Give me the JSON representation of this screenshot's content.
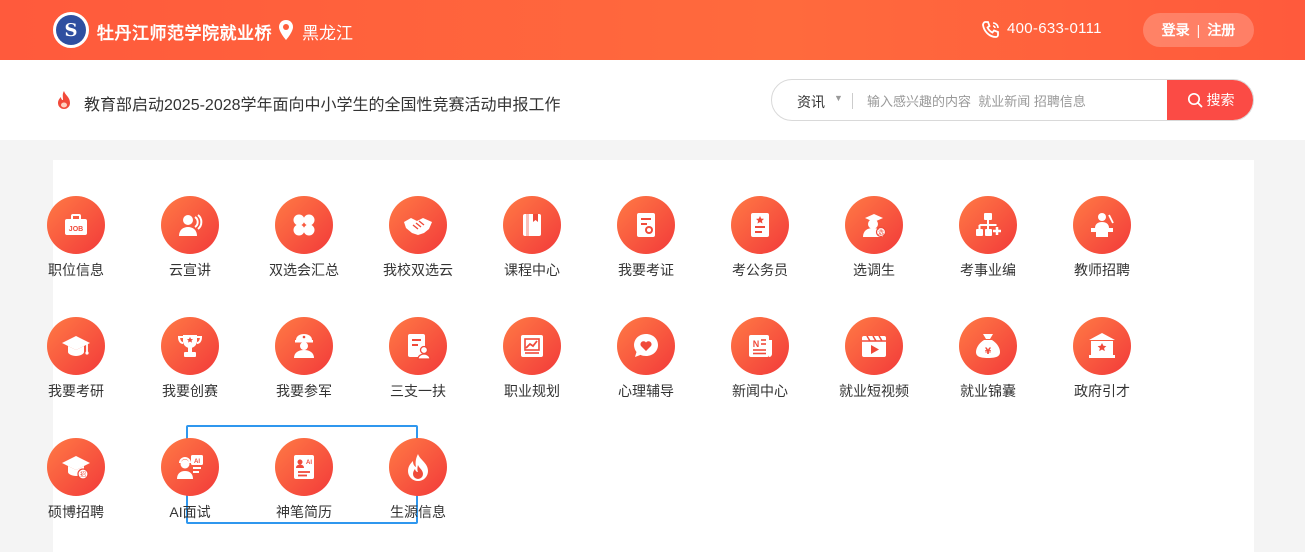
{
  "header": {
    "logo_text": "S",
    "site_name": "牡丹江师范学院就业桥",
    "location": "黑龙江",
    "phone": "400-633-0111",
    "login_label": "登录",
    "separator": "|",
    "register_label": "注册"
  },
  "news": {
    "headline": "教育部启动2025-2028学年面向中小学生的全国性竞赛活动申报工作"
  },
  "search": {
    "category": "资讯",
    "caret": "▼",
    "placeholder": "输入感兴趣的内容  就业新闻 招聘信息",
    "button_label": "搜索"
  },
  "services": [
    {
      "label": "职位信息",
      "icon": "job-icon"
    },
    {
      "label": "云宣讲",
      "icon": "presenter-icon"
    },
    {
      "label": "双选会汇总",
      "icon": "clover-icon"
    },
    {
      "label": "我校双选云",
      "icon": "handshake-icon"
    },
    {
      "label": "课程中心",
      "icon": "book-icon"
    },
    {
      "label": "我要考证",
      "icon": "certificate-icon"
    },
    {
      "label": "考公务员",
      "icon": "document-star-icon"
    },
    {
      "label": "选调生",
      "icon": "official-icon"
    },
    {
      "label": "考事业编",
      "icon": "org-chart-icon"
    },
    {
      "label": "教师招聘",
      "icon": "teacher-icon"
    },
    {
      "label": "我要考研",
      "icon": "graduation-cap-icon"
    },
    {
      "label": "我要创赛",
      "icon": "trophy-icon"
    },
    {
      "label": "我要参军",
      "icon": "soldier-icon"
    },
    {
      "label": "三支一扶",
      "icon": "document-person-icon"
    },
    {
      "label": "职业规划",
      "icon": "chart-board-icon"
    },
    {
      "label": "心理辅导",
      "icon": "heart-bubble-icon"
    },
    {
      "label": "新闻中心",
      "icon": "newspaper-icon"
    },
    {
      "label": "就业短视频",
      "icon": "video-icon"
    },
    {
      "label": "就业锦囊",
      "icon": "money-bag-icon"
    },
    {
      "label": "政府引才",
      "icon": "government-icon"
    },
    {
      "label": "硕博招聘",
      "icon": "doctoral-cap-icon"
    },
    {
      "label": "AI面试",
      "icon": "ai-interview-icon"
    },
    {
      "label": "神笔简历",
      "icon": "ai-resume-icon"
    },
    {
      "label": "生源信息",
      "icon": "flame-icon"
    }
  ]
}
